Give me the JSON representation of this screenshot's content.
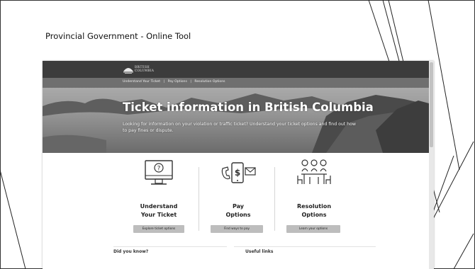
{
  "slide": {
    "heading": "Provincial Government - Online Tool"
  },
  "site": {
    "logo_text_line1": "BRITISH",
    "logo_text_line2": "COLUMBIA",
    "nav": [
      "Understand Your Ticket",
      "Pay Options",
      "Resolution Options"
    ],
    "nav_separator": "|",
    "hero_title": "Ticket information in British Columbia",
    "hero_description": "Looking for information on your violation or traffic ticket? Understand your ticket options and find out how to pay fines or dispute.",
    "cards": [
      {
        "title_line1": "Understand",
        "title_line2": "Your Ticket",
        "button": "Explore ticket options",
        "icon": "monitor-question-icon"
      },
      {
        "title_line1": "Pay",
        "title_line2": "Options",
        "button": "Find ways to pay",
        "icon": "phone-payment-icon"
      },
      {
        "title_line1": "Resolution",
        "title_line2": "Options",
        "button": "Learn your options",
        "icon": "people-meeting-icon"
      }
    ],
    "bottom_headings": [
      "Did you know?",
      "Useful links"
    ]
  }
}
